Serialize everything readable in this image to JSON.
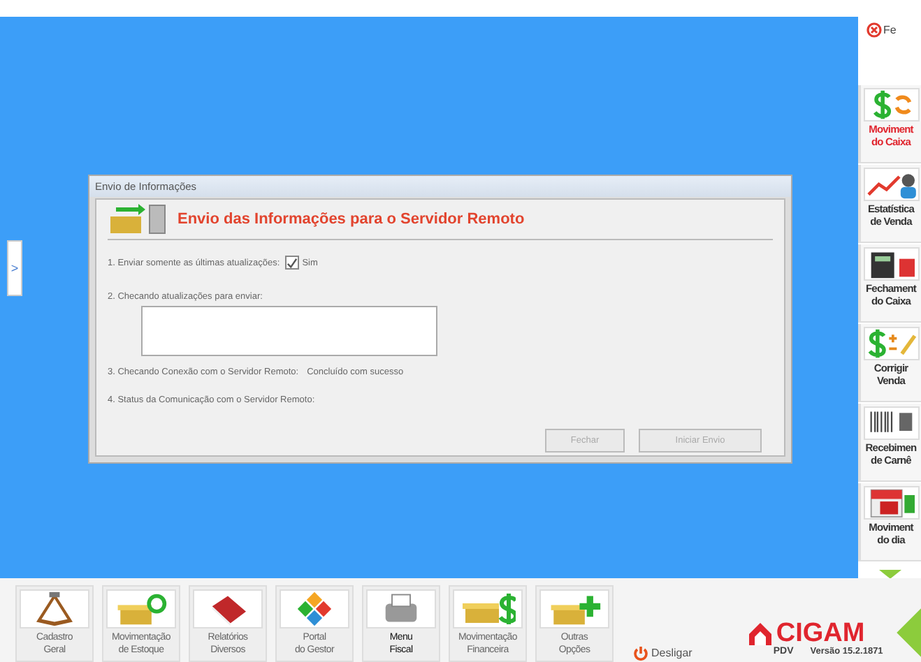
{
  "close_label": "Fe",
  "dialog": {
    "title": "Envio de Informações",
    "heading": "Envio das Informações para o Servidor Remoto",
    "step1": {
      "label": "1. Enviar somente as últimas atualizações:",
      "checkbox": {
        "label": "Sim",
        "checked": true
      }
    },
    "step2": {
      "label": "2. Checando atualizações para enviar:"
    },
    "step3": {
      "label": "3. Checando Conexão com o Servidor Remoto:",
      "status": "Concluído com sucesso"
    },
    "step4": {
      "label": "4. Status da Comunicação com o Servidor Remoto:"
    },
    "buttons": [
      {
        "label": "Fechar",
        "disabled": true
      },
      {
        "label": "Iniciar Envio",
        "disabled": true
      }
    ]
  },
  "side_tab": ">",
  "sidebar": [
    {
      "label": "Moviment do Caixa",
      "selected": true
    },
    {
      "label": "Estatística de Venda",
      "selected": false
    },
    {
      "label": "Fechament do Caixa",
      "selected": false
    },
    {
      "label": "Corrigir Venda",
      "selected": false
    },
    {
      "label": "Recebimen de Carnê",
      "selected": false
    },
    {
      "label": "Moviment do dia",
      "selected": false
    }
  ],
  "bottom_buttons": [
    {
      "label": "Cadastro Geral",
      "selected": false
    },
    {
      "label": "Movimentação de Estoque",
      "selected": false
    },
    {
      "label": "Relatórios Diversos",
      "selected": false
    },
    {
      "label": "Portal do Gestor",
      "selected": false
    },
    {
      "label": "Menu Fiscal",
      "selected": true
    },
    {
      "label": "Movimentação Financeira",
      "selected": false
    },
    {
      "label": "Outras Opções",
      "selected": false
    }
  ],
  "shutdown": "Desligar",
  "brand": {
    "name": "CIGAM",
    "product": "PDV",
    "version": "Versão 15.2.1871"
  }
}
